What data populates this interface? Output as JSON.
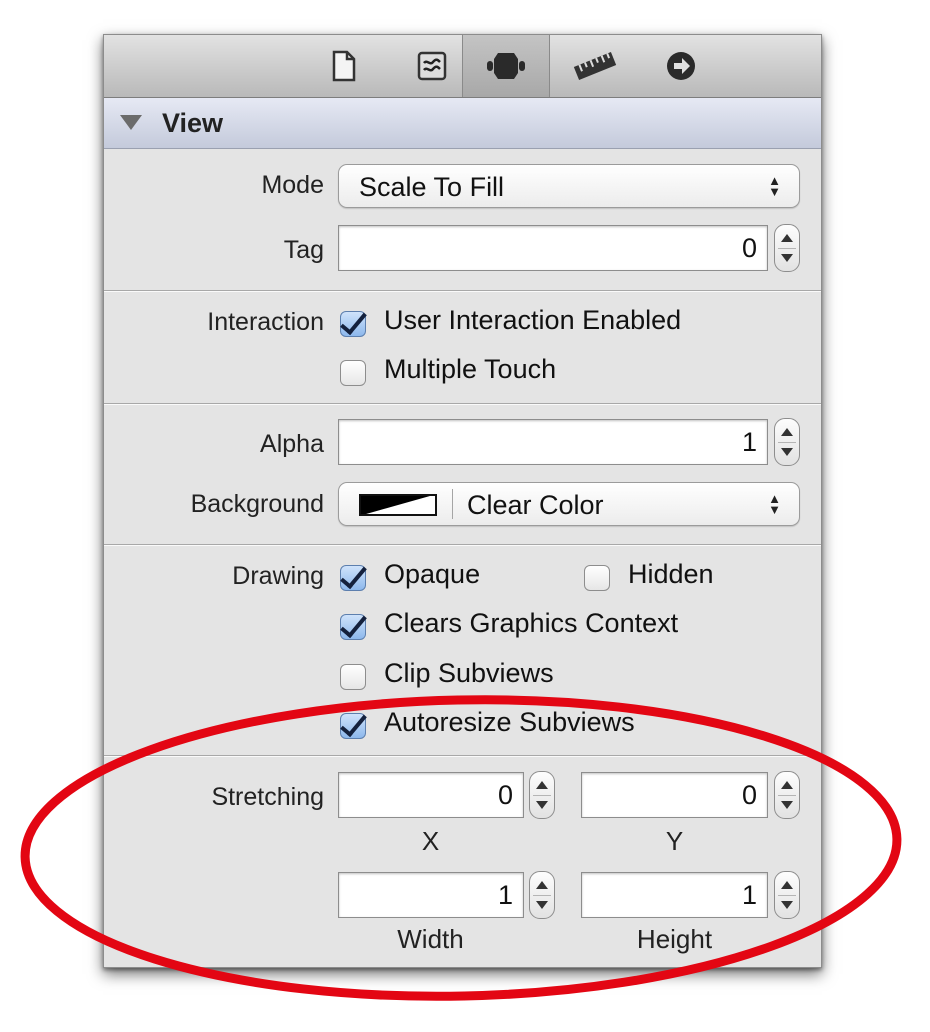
{
  "toolbar": {
    "tabs": [
      {
        "icon": "file-icon"
      },
      {
        "icon": "quick-help-icon"
      },
      {
        "icon": "identity-icon"
      },
      {
        "icon": "attributes-icon",
        "active": true
      },
      {
        "icon": "size-ruler-icon"
      },
      {
        "icon": "connections-arrow-icon"
      }
    ]
  },
  "section": {
    "title": "View"
  },
  "mode": {
    "label": "Mode",
    "value": "Scale To Fill"
  },
  "tag": {
    "label": "Tag",
    "value": "0"
  },
  "interaction": {
    "label": "Interaction",
    "user_interaction": {
      "label": "User Interaction Enabled",
      "checked": true
    },
    "multiple_touch": {
      "label": "Multiple Touch",
      "checked": false
    }
  },
  "alpha": {
    "label": "Alpha",
    "value": "1"
  },
  "background": {
    "label": "Background",
    "value": "Clear Color"
  },
  "drawing": {
    "label": "Drawing",
    "opaque": {
      "label": "Opaque",
      "checked": true
    },
    "hidden": {
      "label": "Hidden",
      "checked": false
    },
    "clears_context": {
      "label": "Clears Graphics Context",
      "checked": true
    },
    "clip_subviews": {
      "label": "Clip Subviews",
      "checked": false
    },
    "autoresize": {
      "label": "Autoresize Subviews",
      "checked": true
    }
  },
  "stretching": {
    "label": "Stretching",
    "x": {
      "value": "0",
      "caption": "X"
    },
    "y": {
      "value": "0",
      "caption": "Y"
    },
    "width": {
      "value": "1",
      "caption": "Width"
    },
    "height": {
      "value": "1",
      "caption": "Height"
    }
  },
  "colors": {
    "callout_ring": "#e30613",
    "header_blue": "#c4cadb",
    "checkbox_blue": "#8db8ec"
  }
}
